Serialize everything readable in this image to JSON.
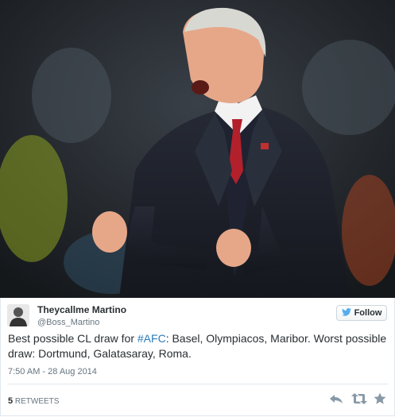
{
  "tweet": {
    "display_name": "Theycallme Martino",
    "handle": "@Boss_Martino",
    "follow_label": "Follow",
    "text_before": "Best possible CL draw for ",
    "hashtag": "#AFC",
    "text_after": ": Basel, Olympiacos, Maribor. Worst possible draw: Dortmund, Galatasaray, Roma.",
    "timestamp": "7:50 AM - 28 Aug 2014",
    "retweet_count": "5",
    "retweet_label": "RETWEETS"
  },
  "icons": {
    "follow": "twitter-bird-icon",
    "reply": "reply-icon",
    "retweet": "retweet-icon",
    "favorite": "star-icon"
  },
  "colors": {
    "link": "#2b7bb9",
    "text": "#292f33",
    "muted": "#66757f",
    "twitter_blue": "#55acee",
    "action_gray": "#8899a6"
  }
}
